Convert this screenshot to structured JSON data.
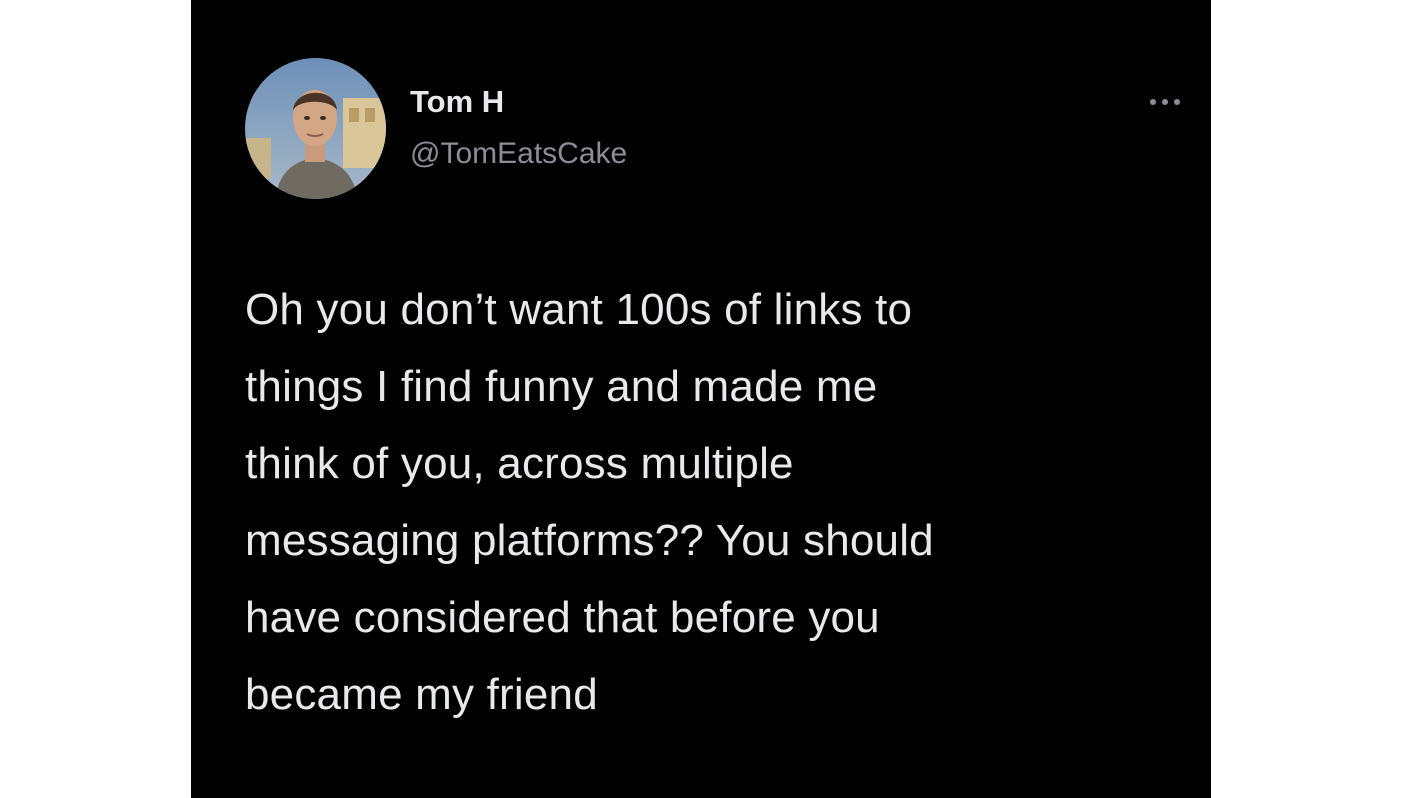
{
  "tweet": {
    "author": {
      "display_name": "Tom H",
      "handle": "@TomEatsCake",
      "avatar_icon": "user-avatar-photo"
    },
    "more_icon": "more-options-icon",
    "text": "Oh you don’t want 100s of links to\nthings I find funny and made me\nthink of you, across multiple\nmessaging platforms?? You should\nhave considered that before you\nbecame my friend"
  },
  "colors": {
    "page_background": "#ffffff",
    "card_background": "#000000",
    "primary_text": "#e7e9ea",
    "secondary_text": "#8b8f94"
  }
}
